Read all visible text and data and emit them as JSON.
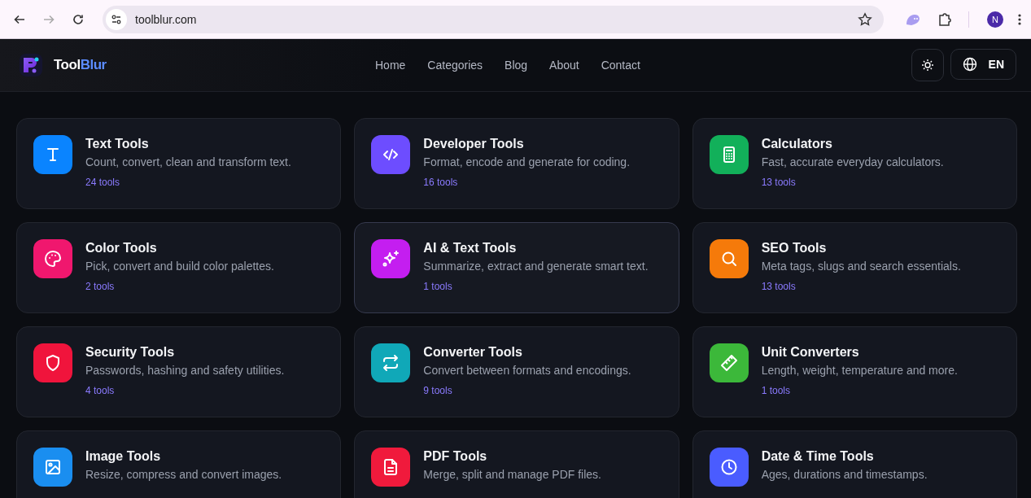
{
  "browser": {
    "url": "toolblur.com",
    "forward_disabled": true,
    "profile_initial": "N"
  },
  "header": {
    "logo_first": "Tool",
    "logo_second": "Blur",
    "nav": [
      {
        "label": "Home"
      },
      {
        "label": "Categories"
      },
      {
        "label": "Blog"
      },
      {
        "label": "About"
      },
      {
        "label": "Contact"
      }
    ],
    "language": "EN"
  },
  "categories": [
    {
      "kind": "text",
      "color": "#0a84ff",
      "title": "Text Tools",
      "description": "Count, convert, clean and transform text.",
      "count": "24 tools",
      "highlighted": false
    },
    {
      "kind": "code",
      "color": "#6d4dff",
      "title": "Developer Tools",
      "description": "Format, encode and generate for coding.",
      "count": "16 tools",
      "highlighted": false
    },
    {
      "kind": "calculator",
      "color": "#12b05a",
      "title": "Calculators",
      "description": "Fast, accurate everyday calculators.",
      "count": "13 tools",
      "highlighted": false
    },
    {
      "kind": "palette",
      "color": "#f0176e",
      "title": "Color Tools",
      "description": "Pick, convert and build color palettes.",
      "count": "2 tools",
      "highlighted": false
    },
    {
      "kind": "sparkle",
      "color": "#c41ef0",
      "title": "AI & Text Tools",
      "description": "Summarize, extract and generate smart text.",
      "count": "1 tools",
      "highlighted": true
    },
    {
      "kind": "search",
      "color": "#f57a0a",
      "title": "SEO Tools",
      "description": "Meta tags, slugs and search essentials.",
      "count": "13 tools",
      "highlighted": false
    },
    {
      "kind": "shield",
      "color": "#f0143c",
      "title": "Security Tools",
      "description": "Passwords, hashing and safety utilities.",
      "count": "4 tools",
      "highlighted": false
    },
    {
      "kind": "arrows",
      "color": "#10a8b8",
      "title": "Converter Tools",
      "description": "Convert between formats and encodings.",
      "count": "9 tools",
      "highlighted": false
    },
    {
      "kind": "ruler",
      "color": "#3cb83a",
      "title": "Unit Converters",
      "description": "Length, weight, temperature and more.",
      "count": "1 tools",
      "highlighted": false
    },
    {
      "kind": "image",
      "color": "#1a8ef0",
      "title": "Image Tools",
      "description": "Resize, compress and convert images.",
      "highlighted": false
    },
    {
      "kind": "document",
      "color": "#f01a3c",
      "title": "PDF Tools",
      "description": "Merge, split and manage PDF files.",
      "highlighted": false
    },
    {
      "kind": "clock",
      "color": "#4a5cff",
      "title": "Date & Time Tools",
      "description": "Ages, durations and timestamps.",
      "highlighted": false
    }
  ]
}
